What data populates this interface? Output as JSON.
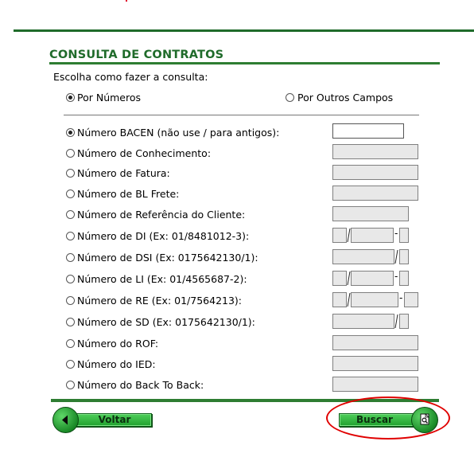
{
  "header": {
    "title": "CONSULTA DE CONTRATOS"
  },
  "instruction": "Escolha como fazer a consulta:",
  "mode_options": [
    {
      "label": "Por Números",
      "checked": true
    },
    {
      "label": "Por Outros Campos",
      "checked": false
    }
  ],
  "fields": [
    {
      "label": "Número BACEN (não use / para antigos):",
      "checked": true
    },
    {
      "label": "Número de Conhecimento:",
      "checked": false
    },
    {
      "label": "Número de Fatura:",
      "checked": false
    },
    {
      "label": "Número de BL Frete:",
      "checked": false
    },
    {
      "label": "Número de Referência do Cliente:",
      "checked": false
    },
    {
      "label": "Número de DI (Ex: 01/8481012-3):",
      "checked": false
    },
    {
      "label": "Número de DSI (Ex: 0175642130/1):",
      "checked": false
    },
    {
      "label": "Número de LI (Ex: 01/4565687-2):",
      "checked": false
    },
    {
      "label": "Número de RE (Ex: 01/7564213):",
      "checked": false
    },
    {
      "label": "Número de SD (Ex: 0175642130/1):",
      "checked": false
    },
    {
      "label": "Número do ROF:",
      "checked": false
    },
    {
      "label": "Número do IED:",
      "checked": false
    },
    {
      "label": "Número do Back To Back:",
      "checked": false
    }
  ],
  "buttons": {
    "back_label": "Voltar",
    "search_label": "Buscar"
  },
  "colors": {
    "brand_green": "#1f6b2a",
    "button_green": "#2eb53b",
    "highlight_red": "#e00000"
  },
  "icons": {
    "back": "arrow-left-icon",
    "search": "document-search-icon"
  }
}
